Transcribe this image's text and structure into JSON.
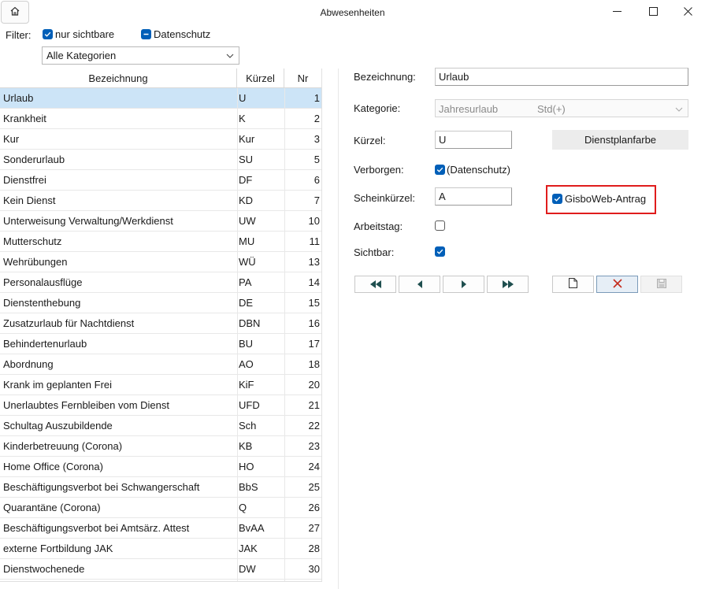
{
  "window": {
    "title": "Abwesenheiten",
    "home_icon": "home-icon",
    "controls": [
      "minimize-icon",
      "maximize-icon",
      "close-icon"
    ]
  },
  "filter": {
    "label": "Filter:",
    "nur_sichtbare": {
      "label": "nur sichtbare",
      "checked": true
    },
    "datenschutz": {
      "label": "Datenschutz",
      "checked": true,
      "state": "indeterminate"
    },
    "category": {
      "value": "Alle Kategorien"
    }
  },
  "table": {
    "columns": [
      "Bezeichnung",
      "Kürzel",
      "Nr"
    ],
    "rows": [
      [
        "Urlaub",
        "U",
        "1"
      ],
      [
        "Krankheit",
        "K",
        "2"
      ],
      [
        "Kur",
        "Kur",
        "3"
      ],
      [
        "Sonderurlaub",
        "SU",
        "5"
      ],
      [
        "Dienstfrei",
        "DF",
        "6"
      ],
      [
        "Kein Dienst",
        "KD",
        "7"
      ],
      [
        "Unterweisung Verwaltung/Werkdienst",
        "UW",
        "10"
      ],
      [
        "Mutterschutz",
        "MU",
        "11"
      ],
      [
        "Wehrübungen",
        "WÜ",
        "13"
      ],
      [
        "Personalausflüge",
        "PA",
        "14"
      ],
      [
        "Dienstenthebung",
        "DE",
        "15"
      ],
      [
        "Zusatzurlaub für Nachtdienst",
        "DBN",
        "16"
      ],
      [
        "Behindertenurlaub",
        "BU",
        "17"
      ],
      [
        "Abordnung",
        "AO",
        "18"
      ],
      [
        "Krank im geplanten Frei",
        "KiF",
        "20"
      ],
      [
        "Unerlaubtes Fernbleiben vom Dienst",
        "UFD",
        "21"
      ],
      [
        "Schultag Auszubildende",
        "Sch",
        "22"
      ],
      [
        "Kinderbetreuung (Corona)",
        "KB",
        "23"
      ],
      [
        "Home Office (Corona)",
        "HO",
        "24"
      ],
      [
        "Beschäftigungsverbot bei Schwangerschaft",
        "BbS",
        "25"
      ],
      [
        "Quarantäne (Corona)",
        "Q",
        "26"
      ],
      [
        "Beschäftigungsverbot bei Amtsärz. Attest",
        "BvAA",
        "27"
      ],
      [
        "externe Fortbildung JAK",
        "JAK",
        "28"
      ],
      [
        "Dienstwochenede",
        "DW",
        "30"
      ]
    ],
    "selected_index": 0
  },
  "detail": {
    "bezeichnung": {
      "label": "Bezeichnung:",
      "value": "Urlaub"
    },
    "kategorie": {
      "label": "Kategorie:",
      "value": "Jahresurlaub",
      "extra": "Std(+)"
    },
    "kuerzel": {
      "label": "Kürzel:",
      "value": "U"
    },
    "dienstplanfarbe_button": "Dienstplanfarbe",
    "verborgen": {
      "label": "Verborgen:",
      "checkbox_label": "(Datenschutz)",
      "checked": true
    },
    "scheinkuerzel": {
      "label": "Scheinkürzel:",
      "value": "A"
    },
    "gisboweb": {
      "label": "GisboWeb-Antrag",
      "checked": true
    },
    "arbeitstag": {
      "label": "Arbeitstag:",
      "checked": false
    },
    "sichtbar": {
      "label": "Sichtbar:",
      "checked": true
    }
  },
  "toolbar": {
    "buttons": [
      "first-icon",
      "previous-icon",
      "next-icon",
      "last-icon",
      "new-document-icon",
      "delete-icon",
      "save-icon"
    ],
    "accent": "#005fb8",
    "highlight": "#e01c1c"
  }
}
